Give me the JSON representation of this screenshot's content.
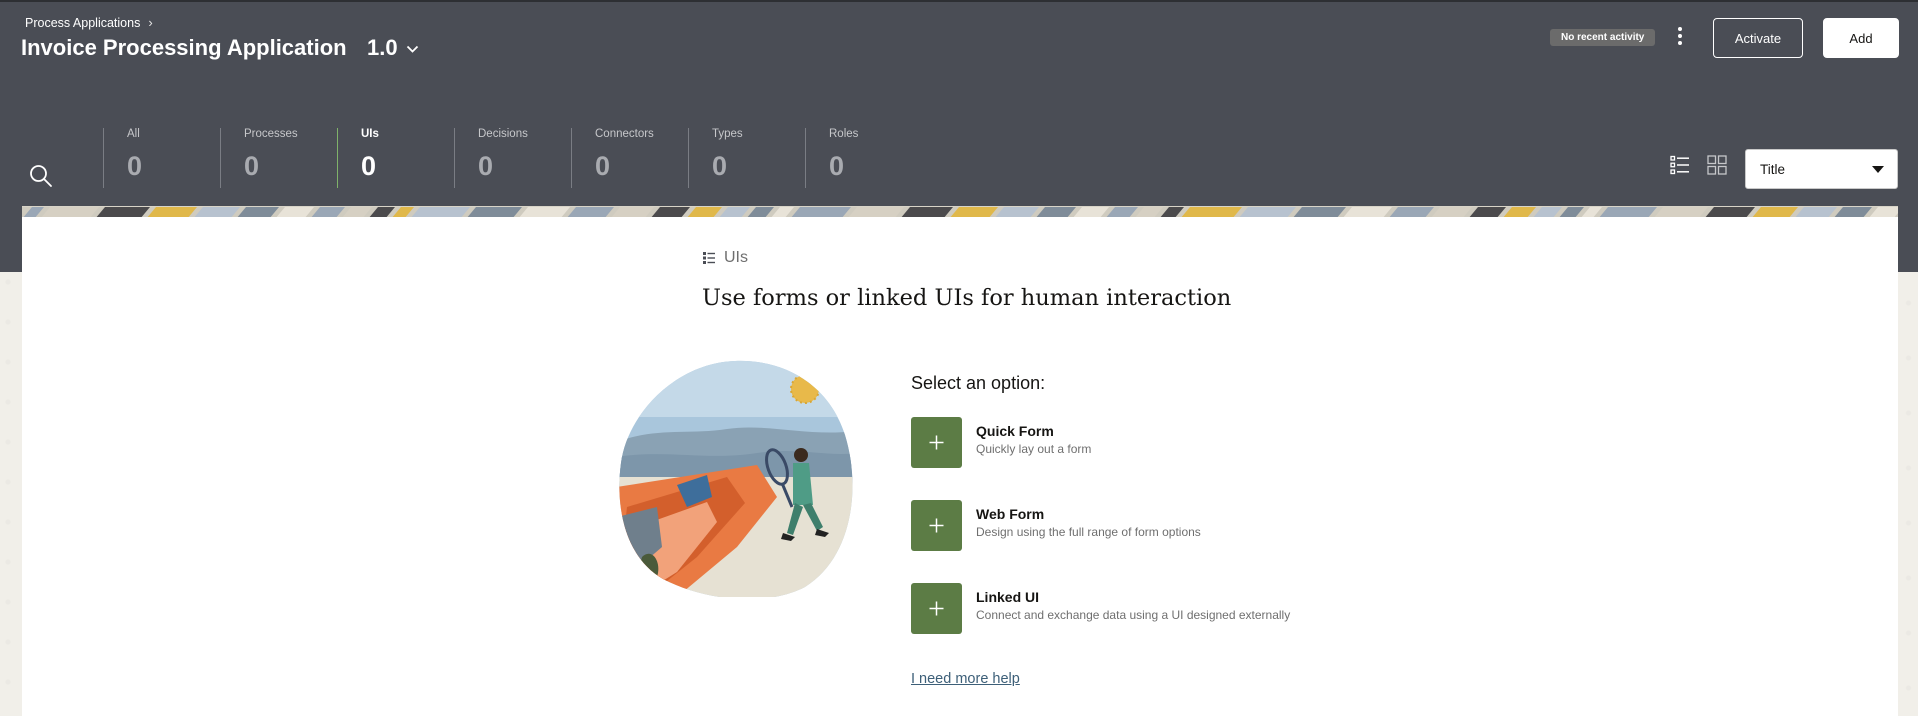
{
  "header": {
    "breadcrumb": "Process Applications",
    "app_title": "Invoice Processing Application",
    "version": "1.0",
    "activity_badge": "No recent activity",
    "activate_label": "Activate",
    "add_label": "Add"
  },
  "tabs": [
    {
      "label": "All",
      "count": "0"
    },
    {
      "label": "Processes",
      "count": "0"
    },
    {
      "label": "UIs",
      "count": "0"
    },
    {
      "label": "Decisions",
      "count": "0"
    },
    {
      "label": "Connectors",
      "count": "0"
    },
    {
      "label": "Types",
      "count": "0"
    },
    {
      "label": "Roles",
      "count": "0"
    }
  ],
  "active_tab": "UIs",
  "sort": {
    "selected": "Title"
  },
  "main": {
    "section_label": "UIs",
    "headline": "Use forms or linked UIs for human interaction",
    "select_label": "Select an option:",
    "options": [
      {
        "title": "Quick Form",
        "desc": "Quickly lay out a form"
      },
      {
        "title": "Web Form",
        "desc": "Design using the full range of form options"
      },
      {
        "title": "Linked UI",
        "desc": "Connect and exchange data using a UI designed externally"
      }
    ],
    "help_link": "I need more help"
  },
  "colors": {
    "header_bg": "#4a4d55",
    "accent_green": "#5c7c45",
    "active_tab_line": "#7fb26a",
    "link": "#3d5f78"
  },
  "icons": {
    "search": "search-icon",
    "list_view": "list-view-icon",
    "grid_view": "grid-view-icon",
    "more": "kebab-menu-icon",
    "plus": "plus-icon",
    "section": "ui-list-icon"
  }
}
